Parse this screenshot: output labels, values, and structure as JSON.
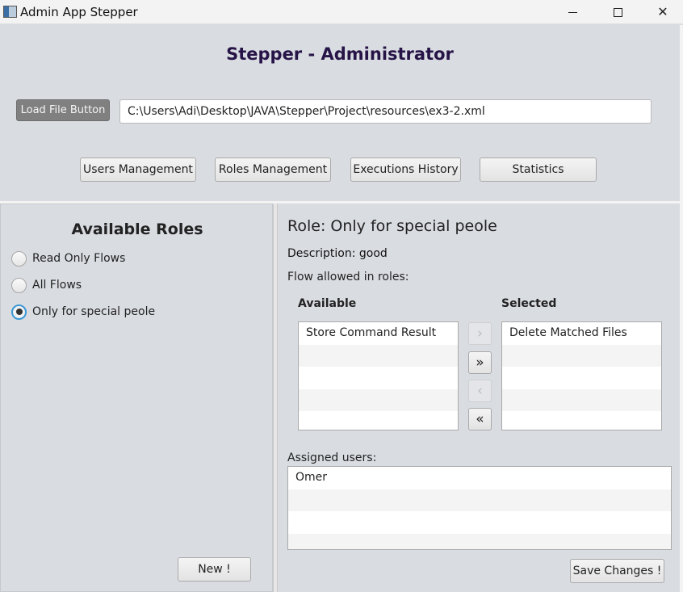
{
  "window": {
    "title": "Admin App Stepper",
    "controls": {
      "minimize": "minimize-icon",
      "maximize": "maximize-icon",
      "close": "✕"
    }
  },
  "header": {
    "title": "Stepper - Administrator",
    "load_button": "Load File Button",
    "file_path": "C:\\Users\\Adi\\Desktop\\JAVA\\Stepper\\Project\\resources\\ex3-2.xml",
    "nav": [
      "Users Management",
      "Roles Management",
      "Executions History",
      "Statistics"
    ]
  },
  "roles_panel": {
    "title": "Available Roles",
    "roles": [
      {
        "label": "Read Only Flows",
        "selected": false
      },
      {
        "label": "All Flows",
        "selected": false
      },
      {
        "label": "Only for special peole",
        "selected": true
      }
    ],
    "new_button": "New !"
  },
  "role_details": {
    "title": "Role: Only for special peole",
    "description": "Description: good",
    "flows_label": "Flow allowed in roles:",
    "available_header": "Available",
    "selected_header": "Selected",
    "available": [
      "Store Command Result",
      "",
      "",
      "",
      ""
    ],
    "selected": [
      "Delete Matched Files",
      "",
      "",
      "",
      ""
    ],
    "arrows": {
      "move_right": "›",
      "move_all_right": "»",
      "move_left": "‹",
      "move_all_left": "«"
    },
    "assigned_label": "Assigned users:",
    "assigned_users": [
      "Omer",
      "",
      "",
      ""
    ],
    "save_button": "Save Changes !"
  }
}
